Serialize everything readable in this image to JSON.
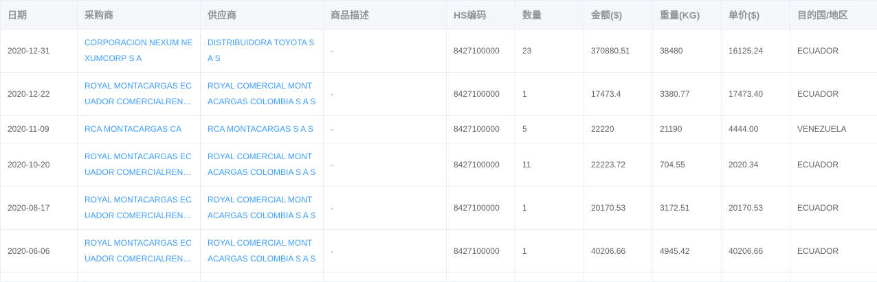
{
  "headers": [
    "日期",
    "采购商",
    "供应商",
    "商品描述",
    "HS编码",
    "数量",
    "金额($)",
    "重量(KG)",
    "单价($)",
    "目的国/地区"
  ],
  "rows": [
    {
      "date": "2020-12-31",
      "buyer": "CORPORACION NEXUM NEXUMCORP S A",
      "supplier": "DISTRIBUIDORA TOYOTA S A S",
      "desc": "-",
      "hs": "8427100000",
      "qty": "23",
      "amount": "370880.51",
      "weight": "38480",
      "unit_price": "16125.24",
      "country": "ECUADOR"
    },
    {
      "date": "2020-12-22",
      "buyer": "ROYAL MONTACARGAS ECUADOR COMERCIALRENTAS S A",
      "supplier": "ROYAL COMERCIAL MONTACARGAS COLOMBIA S A S",
      "desc": "-",
      "hs": "8427100000",
      "qty": "1",
      "amount": "17473.4",
      "weight": "3380.77",
      "unit_price": "17473.40",
      "country": "ECUADOR"
    },
    {
      "date": "2020-11-09",
      "buyer": "RCA MONTACARGAS CA",
      "supplier": "RCA MONTACARGAS S A S",
      "desc": "-",
      "hs": "8427100000",
      "qty": "5",
      "amount": "22220",
      "weight": "21190",
      "unit_price": "4444.00",
      "country": "VENEZUELA"
    },
    {
      "date": "2020-10-20",
      "buyer": "ROYAL MONTACARGAS ECUADOR COMERCIALRENTAS S A",
      "supplier": "ROYAL COMERCIAL MONTACARGAS COLOMBIA S A S",
      "desc": "-",
      "hs": "8427100000",
      "qty": "11",
      "amount": "22223.72",
      "weight": "704.55",
      "unit_price": "2020.34",
      "country": "ECUADOR"
    },
    {
      "date": "2020-08-17",
      "buyer": "ROYAL MONTACARGAS ECUADOR COMERCIALRENTAS S A",
      "supplier": "ROYAL COMERCIAL MONTACARGAS COLOMBIA S A S",
      "desc": "-",
      "hs": "8427100000",
      "qty": "1",
      "amount": "20170.53",
      "weight": "3172.51",
      "unit_price": "20170.53",
      "country": "ECUADOR"
    },
    {
      "date": "2020-06-06",
      "buyer": "ROYAL MONTACARGAS ECUADOR COMERCIALRENTAS S A",
      "supplier": "ROYAL COMERCIAL MONTACARGAS COLOMBIA S A S",
      "desc": "-",
      "hs": "8427100000",
      "qty": "1",
      "amount": "40206.66",
      "weight": "4945.42",
      "unit_price": "40206.66",
      "country": "ECUADOR"
    }
  ],
  "colors": {
    "link": "#409eff",
    "text": "#606266",
    "header_text": "#909399",
    "header_bg": "#f5f7fa",
    "border": "#ebeef5"
  }
}
